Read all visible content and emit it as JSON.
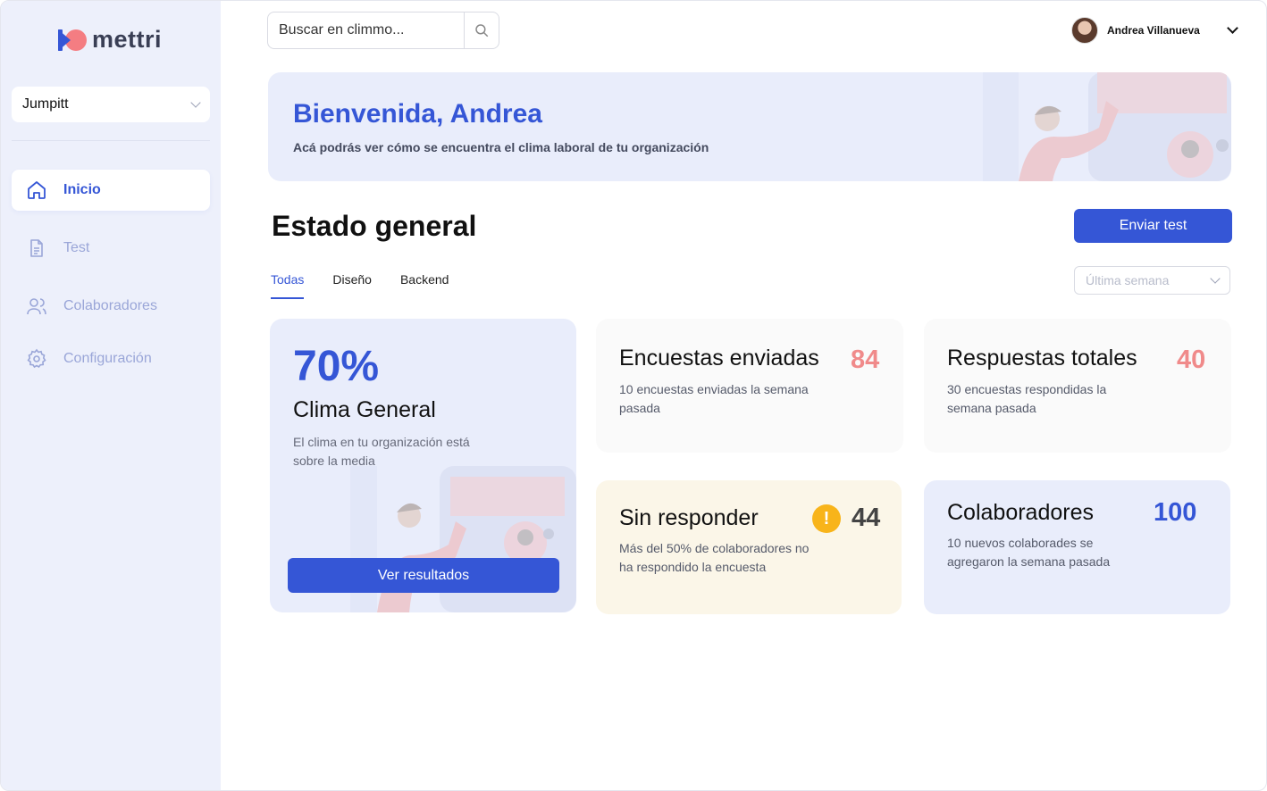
{
  "app": {
    "logo_text": "mettri",
    "brand_color": "#3556d6",
    "accent_color": "#f47d82"
  },
  "sidebar": {
    "workspace": "Jumpitt",
    "items": [
      {
        "label": "Inicio",
        "icon": "home-icon",
        "active": true
      },
      {
        "label": "Test",
        "icon": "document-icon",
        "active": false
      },
      {
        "label": "Colaboradores",
        "icon": "users-icon",
        "active": false
      },
      {
        "label": "Configuración",
        "icon": "gear-icon",
        "active": false
      }
    ]
  },
  "header": {
    "search_placeholder": "Buscar en climmo...",
    "user_name": "Andrea Villanueva"
  },
  "banner": {
    "title": "Bienvenida, Andrea",
    "subtitle": "Acá podrás ver cómo se encuentra el clima laboral de tu organización"
  },
  "section": {
    "title": "Estado general",
    "send_button": "Enviar test",
    "tabs": [
      "Todas",
      "Diseño",
      "Backend"
    ],
    "period_placeholder": "Última semana"
  },
  "main_card": {
    "value": "70%",
    "title": "Clima General",
    "description": "El clima en tu organización está sobre la media",
    "button": "Ver resultados"
  },
  "stats": {
    "sent": {
      "title": "Encuestas enviadas",
      "value": "84",
      "description": "10 encuestas enviadas la semana pasada",
      "color": "#f08a8a"
    },
    "responses": {
      "title": "Respuestas totales",
      "value": "40",
      "description": "30 encuestas respondidas la semana pasada",
      "color": "#f08a8a"
    },
    "unanswered": {
      "title": "Sin responder",
      "value": "44",
      "description": "Más del 50% de colaboradores no ha respondido la encuesta",
      "color": "#444444",
      "warning_glyph": "!"
    },
    "collaborators": {
      "title": "Colaboradores",
      "value": "100",
      "description": "10 nuevos colaborades se agregaron la semana pasada",
      "color": "#3556d6"
    }
  }
}
